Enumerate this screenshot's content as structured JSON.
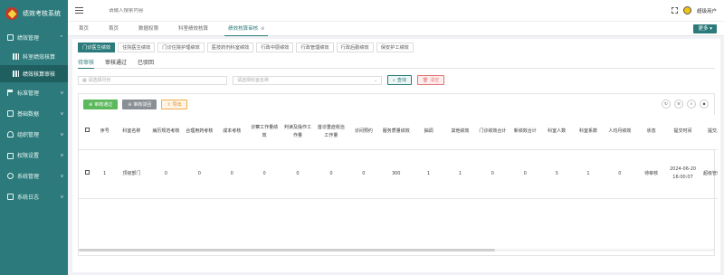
{
  "app": {
    "title": "绩效考核系统"
  },
  "sidebar": {
    "items": [
      {
        "label": "绩效管理",
        "icon": "document-icon"
      },
      {
        "label": "科室绩效核算",
        "icon": "grid-icon"
      },
      {
        "label": "绩效核算审核",
        "icon": "grid-icon"
      },
      {
        "label": "标准管理",
        "icon": "flag-icon"
      },
      {
        "label": "基础数据",
        "icon": "document-icon"
      },
      {
        "label": "组织管理",
        "icon": "user-icon"
      },
      {
        "label": "权限设置",
        "icon": "lock-icon"
      },
      {
        "label": "系统管理",
        "icon": "gear-icon"
      },
      {
        "label": "系统日志",
        "icon": "document-icon"
      }
    ]
  },
  "topbar": {
    "search_placeholder": "请输入搜索内容",
    "username": "超级用户"
  },
  "page_tabs": [
    {
      "label": "首页"
    },
    {
      "label": "首页"
    },
    {
      "label": "数据权限"
    },
    {
      "label": "科室绩效核算"
    },
    {
      "label": "绩效核算审核"
    }
  ],
  "more_label": "更多",
  "category_tabs": [
    "门诊医生绩效",
    "住院医生绩效",
    "门诊住院护理绩效",
    "医技药剂科室绩效",
    "行政中层绩效",
    "行政管理绩效",
    "行政后勤绩效",
    "保安护工绩效"
  ],
  "status_tabs": [
    "待审核",
    "审核通过",
    "已驳回"
  ],
  "filters": {
    "month_placeholder": "请选择月份",
    "dept_placeholder": "请选择科室名称",
    "query": "查询",
    "clear": "清空"
  },
  "ops": {
    "approve": "审核通过",
    "reject": "审核驳回",
    "export": "导出"
  },
  "table": {
    "headers": [
      "序号",
      "科室名称",
      "病历规范考核",
      "合理用药考核",
      "成本考核",
      "诊察工作量绩效",
      "判读及操作工作量",
      "首诊重症收治工作量",
      "诊间预约",
      "服务质量绩效",
      "抽调",
      "其他绩效",
      "门诊绩效合计",
      "新绩效合计",
      "科室人数",
      "科室系数",
      "人均月绩效",
      "状态",
      "提交时间",
      "提交人"
    ],
    "rows": [
      [
        "1",
        "顶级部门",
        "0",
        "0",
        "0",
        "0",
        "0",
        "0",
        "0",
        "300",
        "1",
        "1",
        "0",
        "0",
        "3",
        "1",
        "0",
        "待审核",
        "2024-06-20 16:00:07",
        "超级管理员"
      ]
    ]
  },
  "colors": {
    "primary": "#2c7a7b",
    "sidebar": "#2c7a7b",
    "approve": "#5cb85c",
    "reject": "#8a8f96",
    "export": "#f0ad4e",
    "clear": "#e57373"
  }
}
